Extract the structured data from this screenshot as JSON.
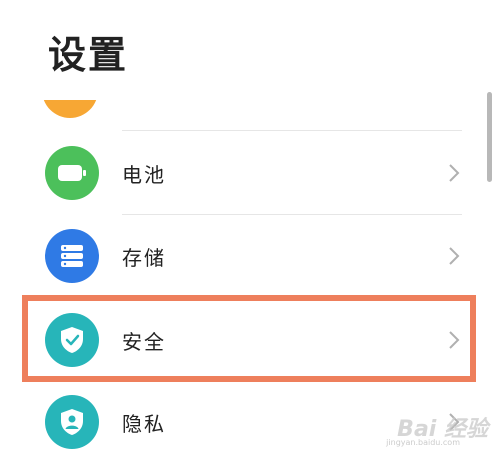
{
  "header": {
    "title": "设置"
  },
  "settings": {
    "items": [
      {
        "label": "电池",
        "icon": "battery-icon",
        "color": "#4cc05b"
      },
      {
        "label": "存储",
        "icon": "storage-icon",
        "color": "#2f7ae5"
      },
      {
        "label": "安全",
        "icon": "shield-check-icon",
        "color": "#27b5b9",
        "highlighted": true
      },
      {
        "label": "隐私",
        "icon": "privacy-shield-icon",
        "color": "#27b5b9"
      }
    ]
  },
  "overlay": {
    "highlight_color": "#ee7f5c",
    "watermark": "Bai 经验",
    "watermark_sub": "jingyan.baidu.com"
  }
}
